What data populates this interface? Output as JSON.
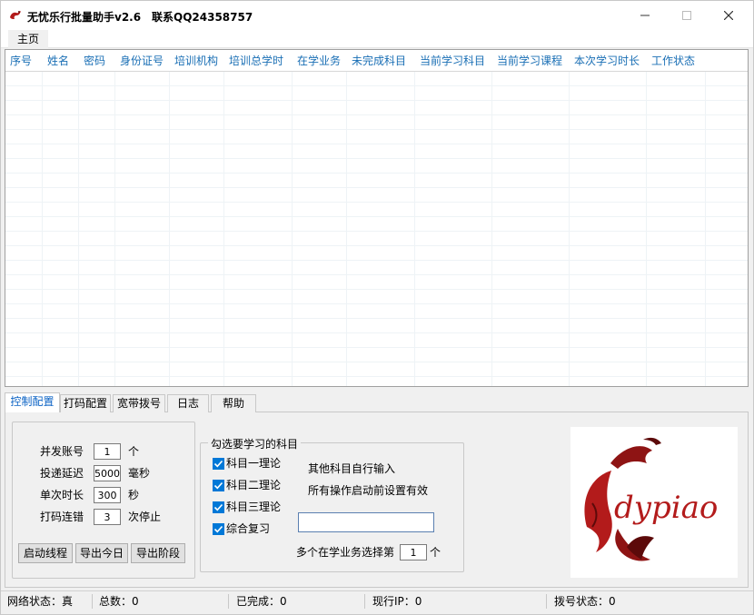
{
  "window": {
    "title": "无忧乐行批量助手v2.6",
    "contact": "联系QQ24358757"
  },
  "menu": {
    "home": "主页"
  },
  "grid": {
    "columns": [
      "序号",
      "姓名",
      "密码",
      "身份证号",
      "培训机构",
      "培训总学时",
      "在学业务",
      "未完成科目",
      "当前学习科目",
      "当前学习课程",
      "本次学习时长",
      "工作状态"
    ]
  },
  "tabs": [
    "控制配置",
    "打码配置",
    "宽带拨号",
    "日志",
    "帮助"
  ],
  "control": {
    "concurrent_label": "并发账号",
    "concurrent_value": "1",
    "concurrent_unit": "个",
    "delay_label": "投递延迟",
    "delay_value": "5000",
    "delay_unit": "毫秒",
    "duration_label": "单次时长",
    "duration_value": "300",
    "duration_unit": "秒",
    "captcha_label": "打码连错",
    "captcha_value": "3",
    "captcha_unit": "次停止",
    "start_button": "启动线程",
    "export_today_button": "导出今日",
    "export_stage_button": "导出阶段"
  },
  "subjects": {
    "group_title": "勾选要学习的科目",
    "items": [
      {
        "label": "科目一理论",
        "checked": true
      },
      {
        "label": "科目二理论",
        "checked": true
      },
      {
        "label": "科目三理论",
        "checked": true
      },
      {
        "label": "综合复习",
        "checked": true
      }
    ],
    "other_hint": "其他科目自行输入",
    "settings_hint": "所有操作启动前设置有效",
    "other_input_value": "",
    "multi_label": "多个在学业务选择第",
    "multi_value": "1",
    "multi_unit": "个"
  },
  "logo": {
    "text": "dypiao",
    "colors": {
      "primary": "#b31b1b",
      "dark": "#5c0a0a"
    }
  },
  "status": {
    "network": "网络状态：真",
    "total": "总数：0",
    "done": "已完成：0",
    "ip": "现行IP：0",
    "dial": "拨号状态：0"
  }
}
